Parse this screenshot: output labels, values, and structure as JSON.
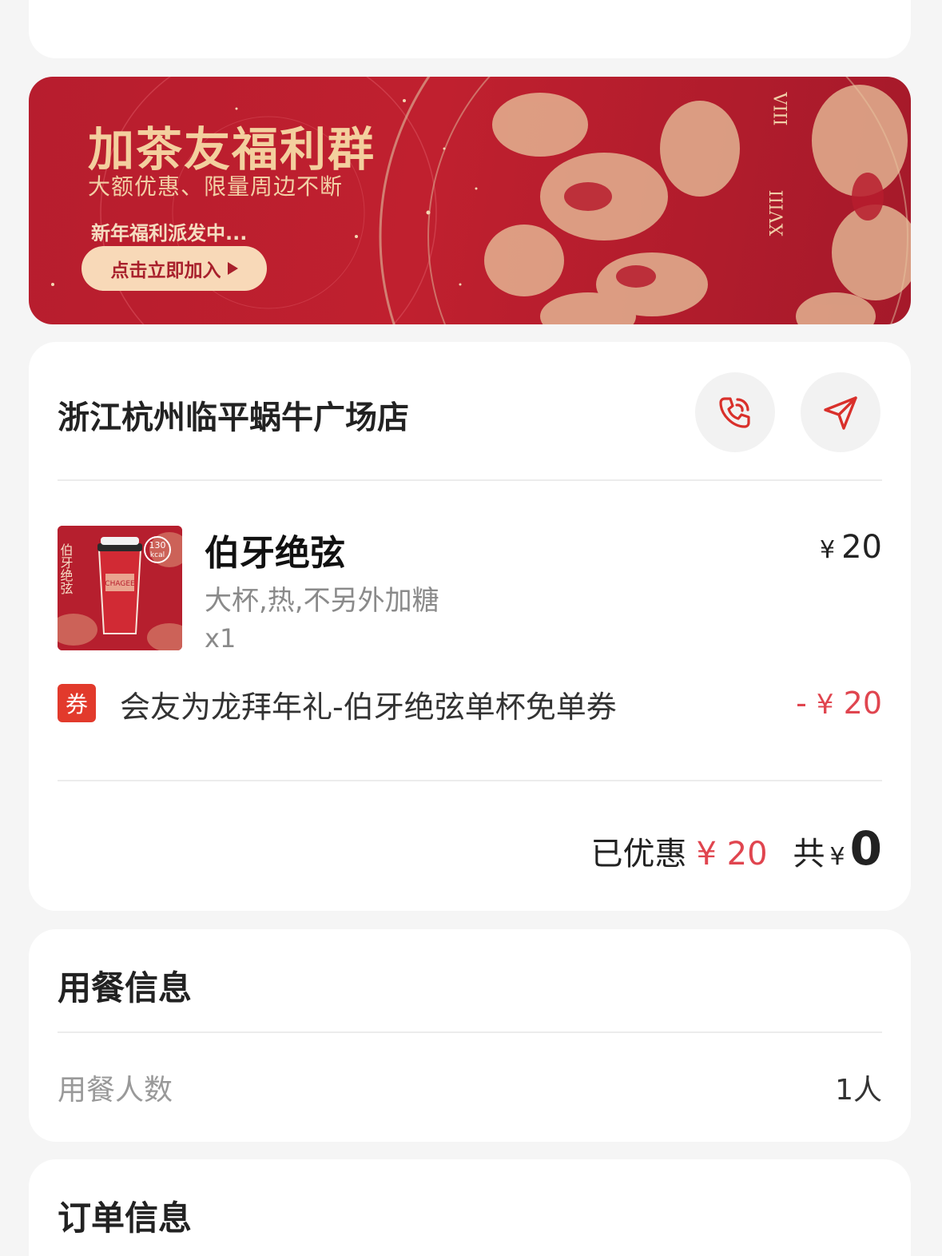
{
  "banner": {
    "title": "加茶友福利群",
    "subtitle": "大额优惠、限量周边不断",
    "note": "新年福利派发中...",
    "button_label": "点击立即加入",
    "numeral_1": "VIII",
    "numeral_2": "XVIII",
    "bg_color": "#b71d2e",
    "accent_color": "#f3cf9e"
  },
  "store": {
    "name": "浙江杭州临平蜗牛广场店",
    "phone_icon": "phone-icon",
    "nav_icon": "navigation-icon"
  },
  "product": {
    "name": "伯牙绝弦",
    "options": "大杯,热,不另外加糖",
    "quantity": "x1",
    "currency": "¥",
    "price": "20",
    "image_text": "伯牙绝弦",
    "kcal_value": "130",
    "kcal_unit": "kcal",
    "cup_brand": "CHAGEE"
  },
  "coupon": {
    "tag": "券",
    "name": "会友为龙拜年礼-伯牙绝弦单杯免单券",
    "amount_prefix": "- ",
    "currency": "¥",
    "amount": "20"
  },
  "summary": {
    "saved_label": "已优惠",
    "saved_amount": "¥ 20",
    "total_label": "共",
    "total_currency": "¥",
    "total_value": "0"
  },
  "dining": {
    "title": "用餐信息",
    "people_label": "用餐人数",
    "people_value": "1人"
  },
  "order": {
    "title": "订单信息"
  },
  "colors": {
    "discount_red": "#e0454f",
    "coupon_tag": "#e23a2c",
    "icon_red": "#d9302b"
  }
}
